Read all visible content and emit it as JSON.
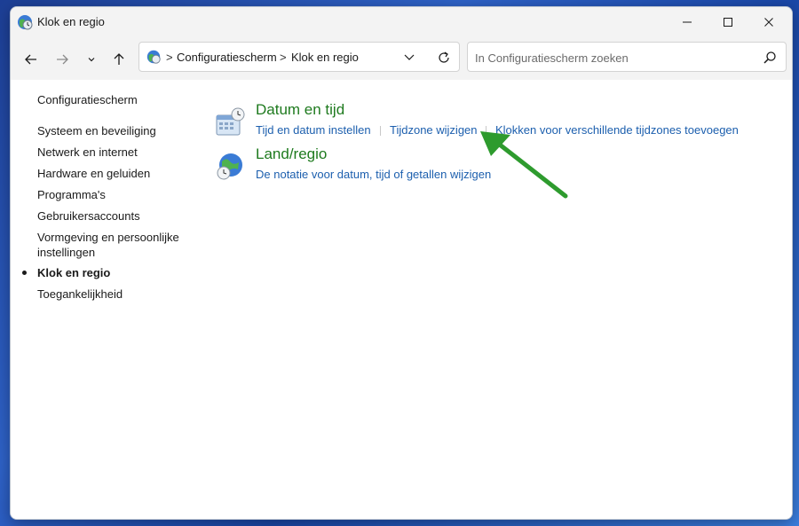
{
  "window": {
    "title": "Klok en regio"
  },
  "address": {
    "crumbs": [
      "Configuratiescherm",
      "Klok en regio"
    ],
    "separator": ">"
  },
  "search": {
    "placeholder": "In Configuratiescherm zoeken"
  },
  "sidebar": {
    "items": [
      {
        "label": "Configuratiescherm"
      },
      {
        "label": "Systeem en beveiliging"
      },
      {
        "label": "Netwerk en internet"
      },
      {
        "label": "Hardware en geluiden"
      },
      {
        "label": "Programma's"
      },
      {
        "label": "Gebruikersaccounts"
      },
      {
        "label": "Vormgeving en persoonlijke instellingen"
      },
      {
        "label": "Klok en regio",
        "active": true
      },
      {
        "label": "Toegankelijkheid"
      }
    ]
  },
  "categories": [
    {
      "title": "Datum en tijd",
      "icon": "calendar-clock-icon",
      "links": [
        "Tijd en datum instellen",
        "Tijdzone wijzigen",
        "Klokken voor verschillende tijdzones toevoegen"
      ]
    },
    {
      "title": "Land/regio",
      "icon": "globe-clock-icon",
      "links": [
        "De notatie voor datum, tijd of getallen wijzigen"
      ]
    }
  ],
  "colors": {
    "category_title": "#1e7a1e",
    "link": "#1c5fae",
    "annotation_arrow": "#2e9b2e"
  }
}
